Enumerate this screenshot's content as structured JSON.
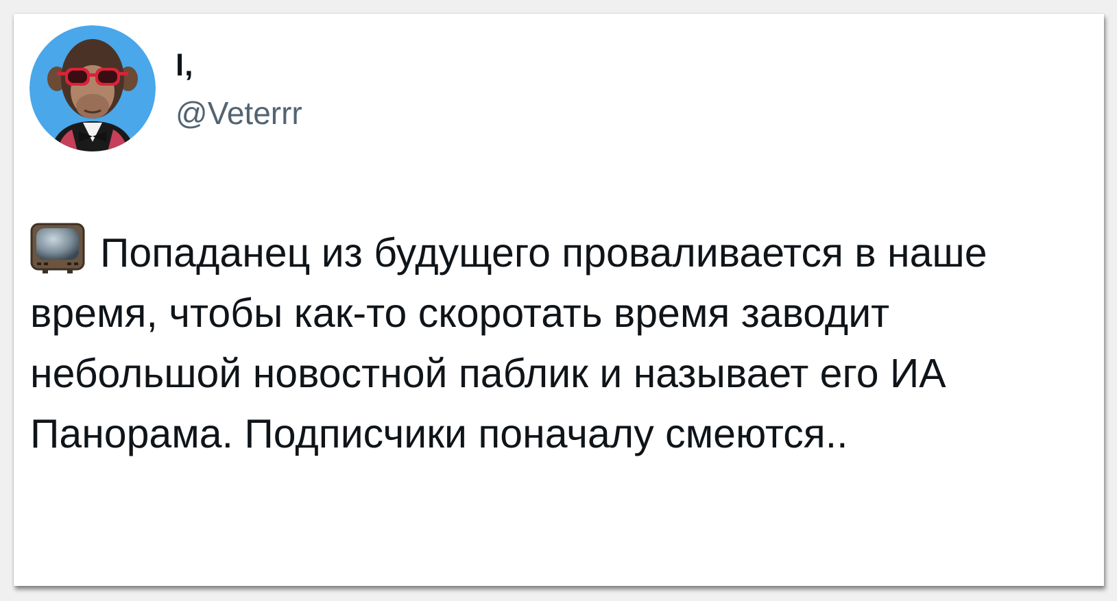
{
  "tweet": {
    "author": {
      "display_name": "l,",
      "handle": "@Veterrr",
      "avatar_icon": "monkey-avatar-icon"
    },
    "text_icon": "television-icon",
    "text": "Попаданец из будущего проваливается в наше время, чтобы как-то скоротать время заводит небольшой новостной паблик и называет его ИА Панорама. Подписчики поначалу смеются.."
  },
  "colors": {
    "background": "#ffffff",
    "text_primary": "#0f1419",
    "text_secondary": "#536471",
    "avatar_bg": "#3fa0e6"
  }
}
